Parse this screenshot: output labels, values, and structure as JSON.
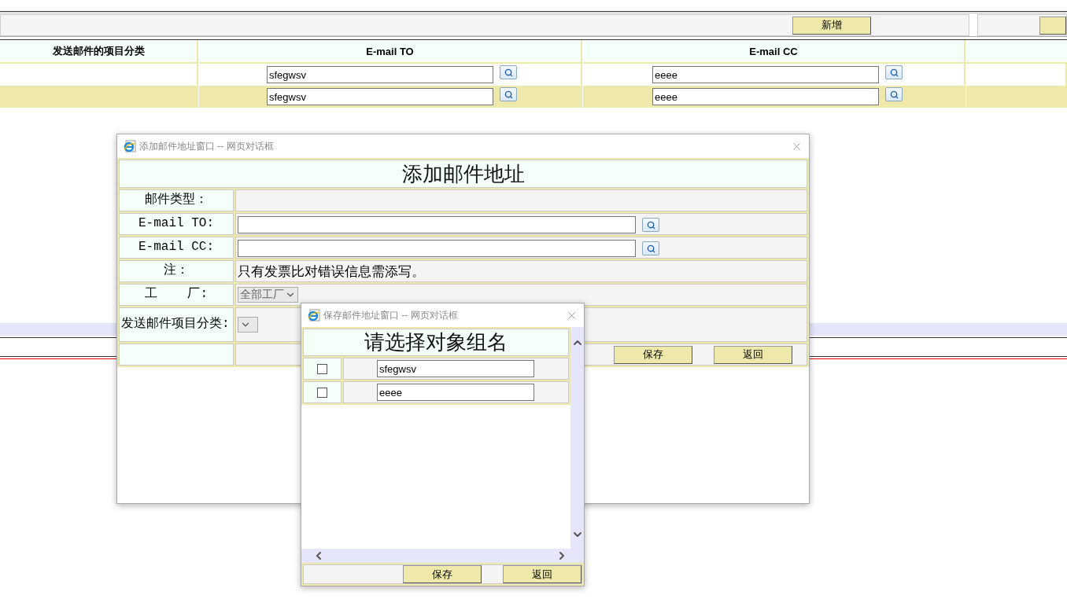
{
  "toolbar": {
    "buttons": [
      "新增"
    ]
  },
  "table": {
    "columns": [
      "发送邮件的项目分类",
      "E-mail TO",
      "E-mail CC"
    ],
    "rows": [
      {
        "shaded": false,
        "email_to": "sfegwsv",
        "email_cc": "eeee"
      },
      {
        "shaded": true,
        "email_to": "sfegwsv",
        "email_cc": "eeee"
      }
    ]
  },
  "add_dialog": {
    "title": "添加邮件地址窗口 -- 网页对话框",
    "heading": "添加邮件地址",
    "rows": [
      {
        "kind": "empty",
        "label": "邮件类型："
      },
      {
        "kind": "lookup",
        "label": "E-mail TO:"
      },
      {
        "kind": "lookup",
        "label": "E-mail CC:"
      },
      {
        "kind": "note",
        "label": "注：",
        "text": "只有发票比对错误信息需添写。"
      },
      {
        "kind": "select",
        "label": "工    厂:",
        "value": "全部工厂"
      },
      {
        "kind": "select",
        "label": "发送邮件项目分类:"
      }
    ],
    "buttons": [
      "保存",
      "返回"
    ]
  },
  "group_dialog": {
    "title": "保存邮件地址窗口 -- 网页对话框",
    "heading": "请选择对象组名",
    "groups": [
      {
        "name": "sfegwsv",
        "checked": false
      },
      {
        "name": "eeee",
        "checked": false
      }
    ],
    "buttons": [
      "保存",
      "返回"
    ]
  }
}
